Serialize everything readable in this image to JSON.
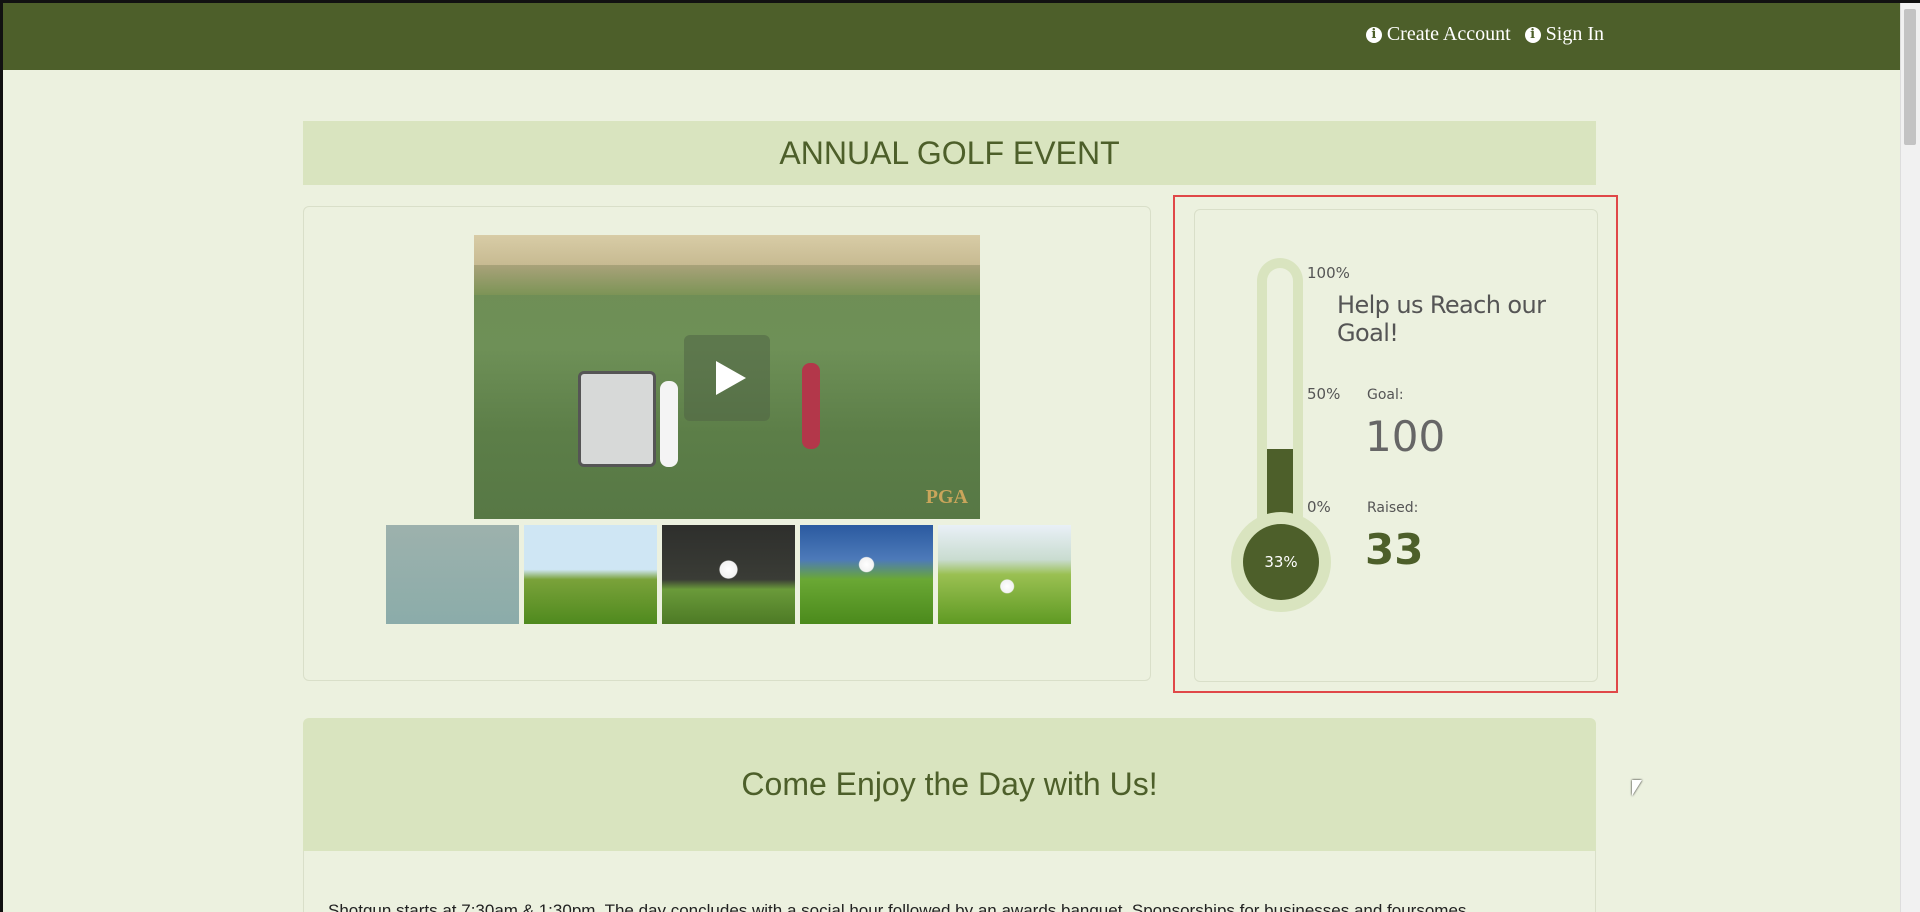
{
  "header": {
    "create_account_label": "Create Account",
    "sign_in_label": "Sign In"
  },
  "event": {
    "title": "ANNUAL GOLF EVENT"
  },
  "media": {
    "thumbnails": [
      "thumb-1",
      "thumb-2",
      "thumb-3",
      "thumb-4",
      "thumb-5"
    ],
    "logo_text": "PGA"
  },
  "goal_widget": {
    "heading": "Help us Reach our Goal!",
    "scale_100": "100%",
    "scale_50": "50%",
    "scale_0": "0%",
    "percent_label": "33%",
    "percent_fill": 0.33,
    "goal_label": "Goal:",
    "goal_value": "100",
    "raised_label": "Raised:",
    "raised_value": "33"
  },
  "section": {
    "title": "Come Enjoy the Day with Us!",
    "body_text": "Shotgun starts at 7:30am & 1:30pm. The day concludes with a social hour followed by an awards banquet. Sponsorships for businesses and foursomes"
  },
  "colors": {
    "brand_green": "#4d5f2a",
    "light_green": "#d9e4bf",
    "page_bg": "#ecf1df",
    "highlight_red": "#e04848"
  }
}
